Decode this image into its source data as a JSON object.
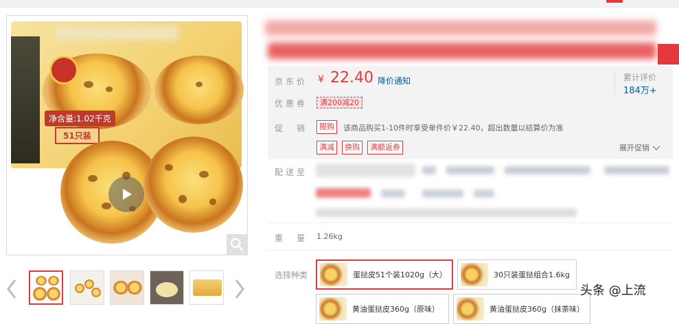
{
  "product": {
    "price_label": "京东价",
    "currency": "¥",
    "price": "22.40",
    "price_notify": "降价通知",
    "review_label": "累计评价",
    "review_count": "184万+",
    "coupon_label": "优惠券",
    "coupon": "满200减20",
    "promo_label": "促　销",
    "promo_tags": [
      "限购",
      "满减",
      "换购",
      "满额返券"
    ],
    "promo_text": "该商品购买1-10件时享受单件价￥22.40，超出数量以结算价为准",
    "expand_label": "展开促销",
    "delivery_label": "配送至",
    "weight_label": "重　量",
    "weight": "1.26kg",
    "variant_label": "选择种类",
    "variants": [
      "蛋挞皮51个装1020g（大）",
      "30只装蛋挞组合1.6kg",
      "黄油蛋挞皮360g（原味）",
      "黄油蛋挞皮360g（抹茶味）"
    ]
  },
  "image": {
    "net_content": "净含量:1.02千克",
    "count": "51只装"
  },
  "watermark": "头条 @上流",
  "colors": {
    "accent": "#e4393c",
    "link": "#005ea7"
  }
}
